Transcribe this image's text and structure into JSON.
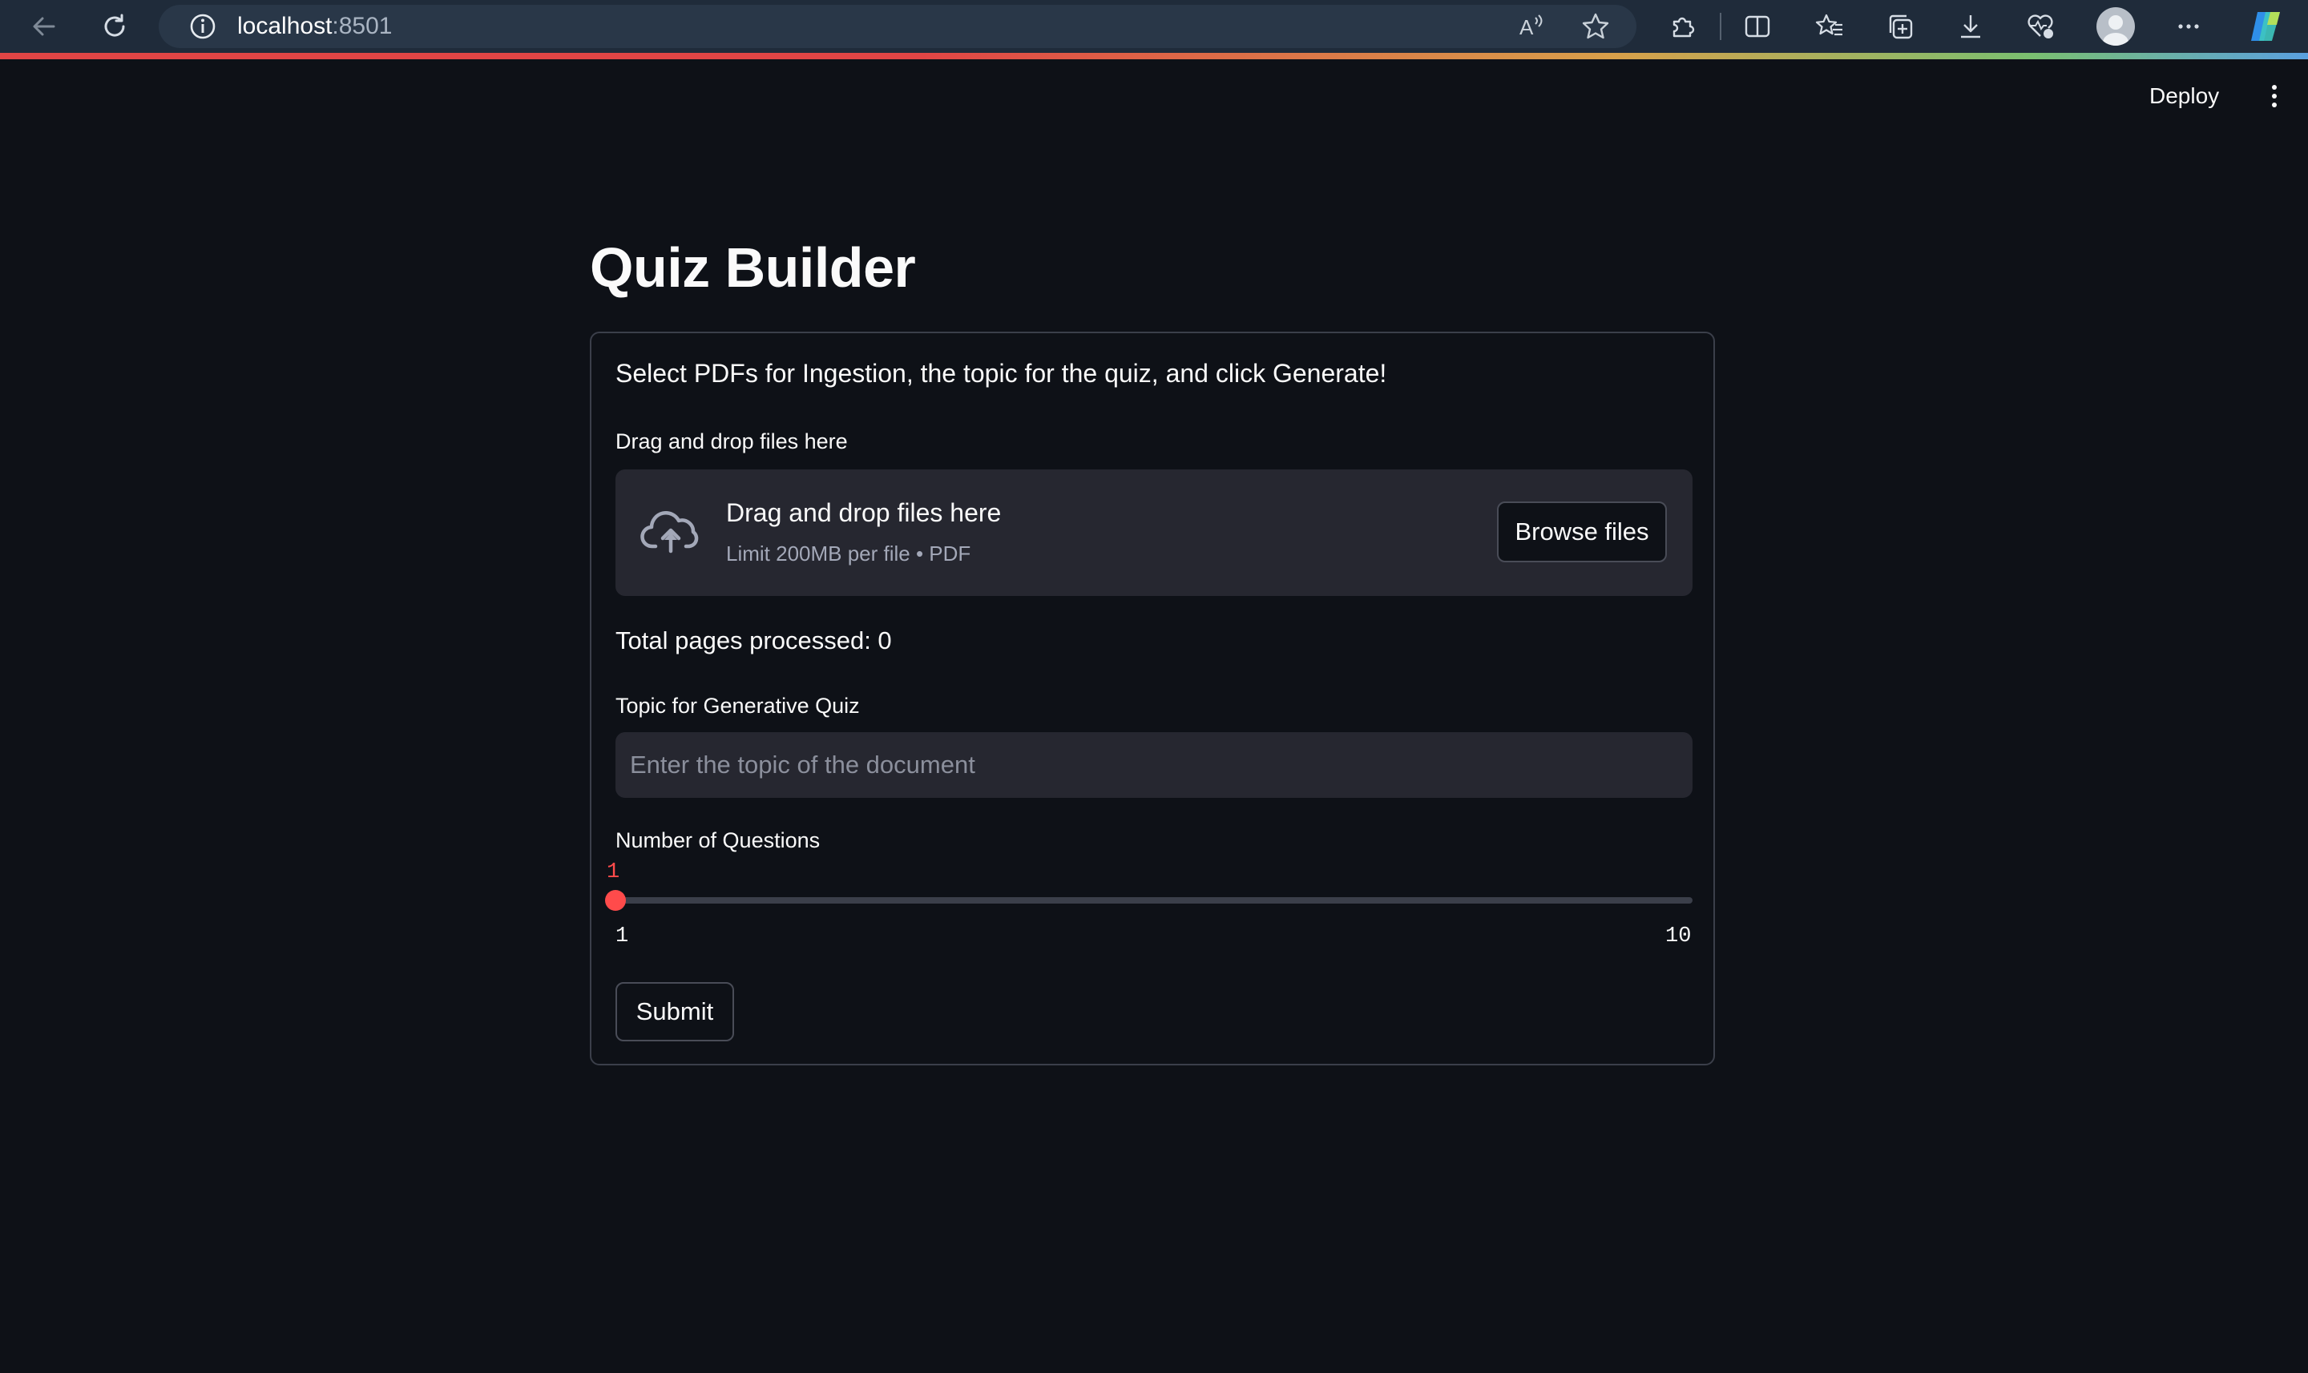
{
  "browser": {
    "url_host": "localhost",
    "url_port": ":8501",
    "icons": [
      "back-icon",
      "refresh-icon",
      "info-icon",
      "read-aloud-icon",
      "favorite-star-icon",
      "extensions-icon",
      "split-screen-icon",
      "favorites-icon",
      "collections-icon",
      "download-icon",
      "browser-essentials-icon",
      "profile-avatar",
      "more-icon",
      "copilot-icon"
    ]
  },
  "header": {
    "deploy_label": "Deploy",
    "menu_icon": "kebab-menu-icon"
  },
  "page": {
    "title": "Quiz Builder",
    "intro": "Select PDFs for Ingestion, the topic for the quiz, and click Generate!"
  },
  "uploader": {
    "label": "Drag and drop files here",
    "dropzone_title": "Drag and drop files here",
    "dropzone_limit": "Limit 200MB per file • PDF",
    "browse_label": "Browse files",
    "icon": "cloud-upload-icon"
  },
  "stats": {
    "pages_processed": "Total pages processed: 0"
  },
  "topic": {
    "label": "Topic for Generative Quiz",
    "placeholder": "Enter the topic of the document",
    "value": ""
  },
  "questions": {
    "label": "Number of Questions",
    "value": 1,
    "value_text": "1",
    "min": 1,
    "max": 10,
    "min_text": "1",
    "max_text": "10"
  },
  "submit": {
    "label": "Submit"
  },
  "colors": {
    "background": "#0e1117",
    "accent": "#ff4b4b",
    "widget_bg": "#262730",
    "browser_bar": "#1f2b3a"
  }
}
